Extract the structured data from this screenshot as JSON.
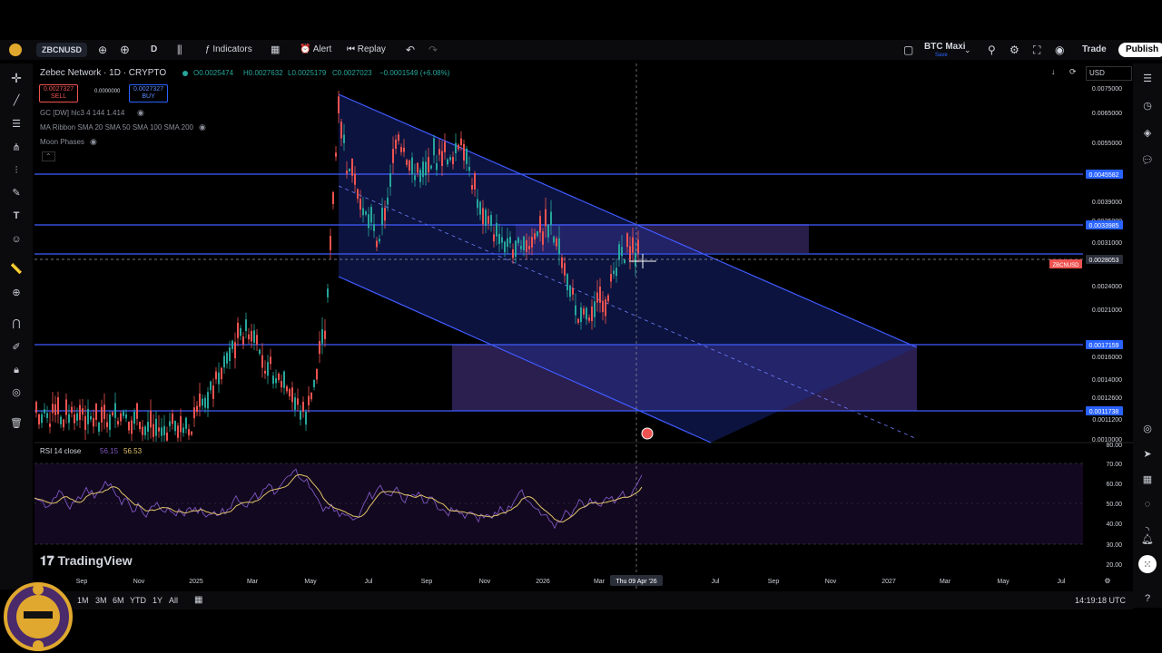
{
  "topbar": {
    "symbol": "ZBCNUSD",
    "interval": "D",
    "indicators": "Indicators",
    "alert": "Alert",
    "replay": "Replay",
    "layout_name": "BTC Maxi",
    "layout_sub": "Save",
    "trade": "Trade",
    "publish": "Publish"
  },
  "legend": {
    "title": "Zebec Network · 1D · CRYPTO",
    "open": "O0.0025474",
    "high": "H0.0027632",
    "low": "L0.0025179",
    "close": "C0.0027023",
    "change": "−0.0001549 (+6.08%)",
    "sell_price": "0.0027327",
    "sell_label": "SELL",
    "spread": "0.0000000",
    "buy_price": "0.0027327",
    "buy_label": "BUY",
    "ind1": "GC [DW] hlc3 4 144 1.414",
    "ind2": "MA Ribbon SMA 20 SMA 50 SMA 100 SMA 200",
    "ind3": "Moon Phases",
    "currency": "USD"
  },
  "price_axis": [
    "0.0075000",
    "0.0065000",
    "0.0055000",
    "0.0039000",
    "0.0035000",
    "0.0031000",
    "0.0024000",
    "0.0021000",
    "0.0016000",
    "0.0014000",
    "0.0012600",
    "0.0011200",
    "0.0010000"
  ],
  "price_labels": {
    "l1": "0.0045582",
    "l2": "0.0033985",
    "l3": "0.0028053",
    "l4": "0.0017159",
    "l5": "0.0011738",
    "symbol_tag": "ZBCNUSD"
  },
  "rsi": {
    "label": "RSI 14 close",
    "value1": "56.15",
    "value2": "56.53",
    "axis": [
      "80.00",
      "70.00",
      "60.00",
      "50.00",
      "40.00",
      "30.00",
      "20.00"
    ]
  },
  "time_axis": [
    "Sep",
    "Nov",
    "2025",
    "Mar",
    "May",
    "Jul",
    "Sep",
    "Nov",
    "2026",
    "Mar",
    "Jul",
    "Sep",
    "Nov",
    "2027",
    "Mar",
    "May",
    "Jul"
  ],
  "crosshair_date": "Thu 09 Apr '26",
  "watermark": "TradingView",
  "ranges": [
    "1M",
    "3M",
    "6M",
    "YTD",
    "1Y",
    "All"
  ],
  "clock": "14:19:18 UTC",
  "colors": {
    "accent": "#2962ff",
    "line": "#3f5bff",
    "zone": "#3a2a6a",
    "up": "#26a69a",
    "down": "#ef5350",
    "rsi": "#7e57c2"
  }
}
